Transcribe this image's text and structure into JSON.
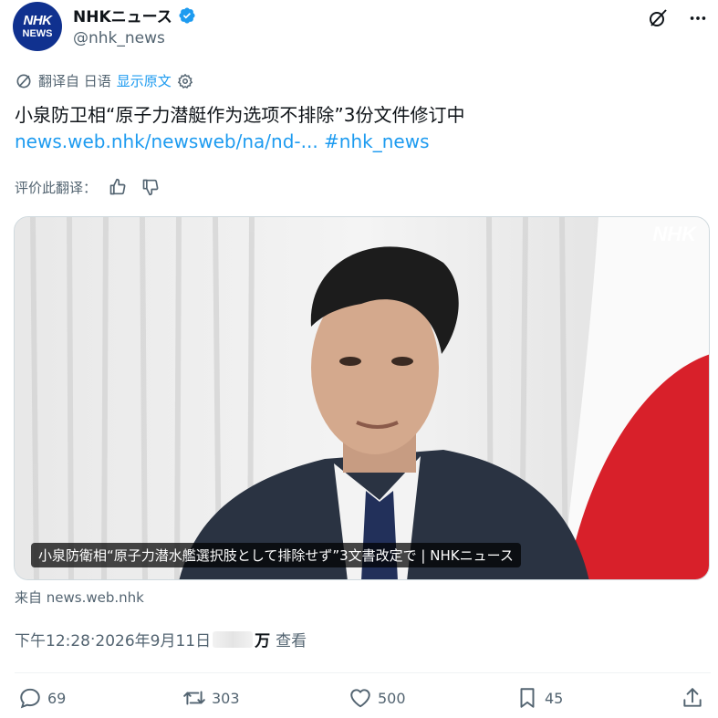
{
  "account": {
    "avatar_line1": "NHK",
    "avatar_line2": "NEWS",
    "name": "NHKニュース",
    "handle": "@nhk_news",
    "brand_color": "#10318f",
    "verified_color": "#1d9bf0"
  },
  "header_icons": [
    "grok-icon",
    "more-icon"
  ],
  "translation": {
    "source_label": "翻译自 日语",
    "show_original": "显示原文",
    "rate_label": "评价此翻译："
  },
  "post": {
    "text": "小泉防卫相“原子力潜艇作为选项不排除”3份文件修订中",
    "link": "news.web.nhk/newsweb/na/nd-...",
    "hashtag": "#nhk_news"
  },
  "media": {
    "watermark": "NHK",
    "caption": "小泉防衛相“原子力潜水艦選択肢として排除せず”3文書改定で | NHKニュース"
  },
  "source": "来自 news.web.nhk",
  "meta": {
    "time": "下午12:28",
    "separator": " · ",
    "date": "2026年9月11日",
    "views_unit": "万",
    "views_label": "查看"
  },
  "actions": {
    "reply": "69",
    "repost": "303",
    "like": "500",
    "bookmark": "45"
  },
  "colors": {
    "text": "#0f1419",
    "muted": "#536471",
    "link": "#1d9bf0"
  }
}
